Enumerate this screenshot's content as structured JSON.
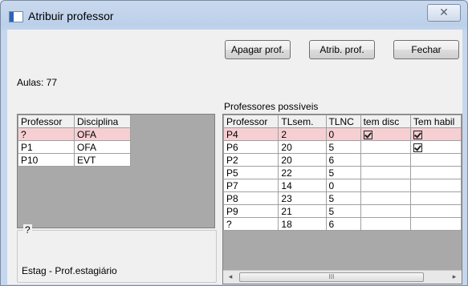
{
  "window": {
    "title": "Atribuir professor",
    "close_glyph": "✕"
  },
  "buttons": {
    "apagar": "Apagar prof.",
    "atrib": "Atrib. prof.",
    "fechar": "Fechar"
  },
  "aulas_label": "Aulas: 77",
  "possible_label": "Professores possíveis",
  "assigned_table": {
    "headers": [
      "Professor",
      "Disciplina"
    ],
    "rows": [
      [
        "?",
        "OFA"
      ],
      [
        "P1",
        "OFA"
      ],
      [
        "P10",
        "EVT"
      ]
    ]
  },
  "details": {
    "group_title": "?",
    "text": "Estag - Prof.estagiário"
  },
  "possible_table": {
    "headers": [
      "Professor",
      "TLsem.",
      "TLNC",
      "tem disc",
      "Tem habil"
    ],
    "rows": [
      [
        "P4",
        "2",
        "0",
        true,
        true
      ],
      [
        "P6",
        "20",
        "5",
        false,
        true
      ],
      [
        "P2",
        "20",
        "6",
        false,
        false
      ],
      [
        "P5",
        "22",
        "5",
        false,
        false
      ],
      [
        "P7",
        "14",
        "0",
        false,
        false
      ],
      [
        "P8",
        "23",
        "5",
        false,
        false
      ],
      [
        "P9",
        "21",
        "5",
        false,
        false
      ],
      [
        "?",
        "18",
        "6",
        false,
        false
      ]
    ]
  },
  "scrollbar": {
    "left": "◂",
    "right": "▸",
    "thumb_grip": "III"
  }
}
